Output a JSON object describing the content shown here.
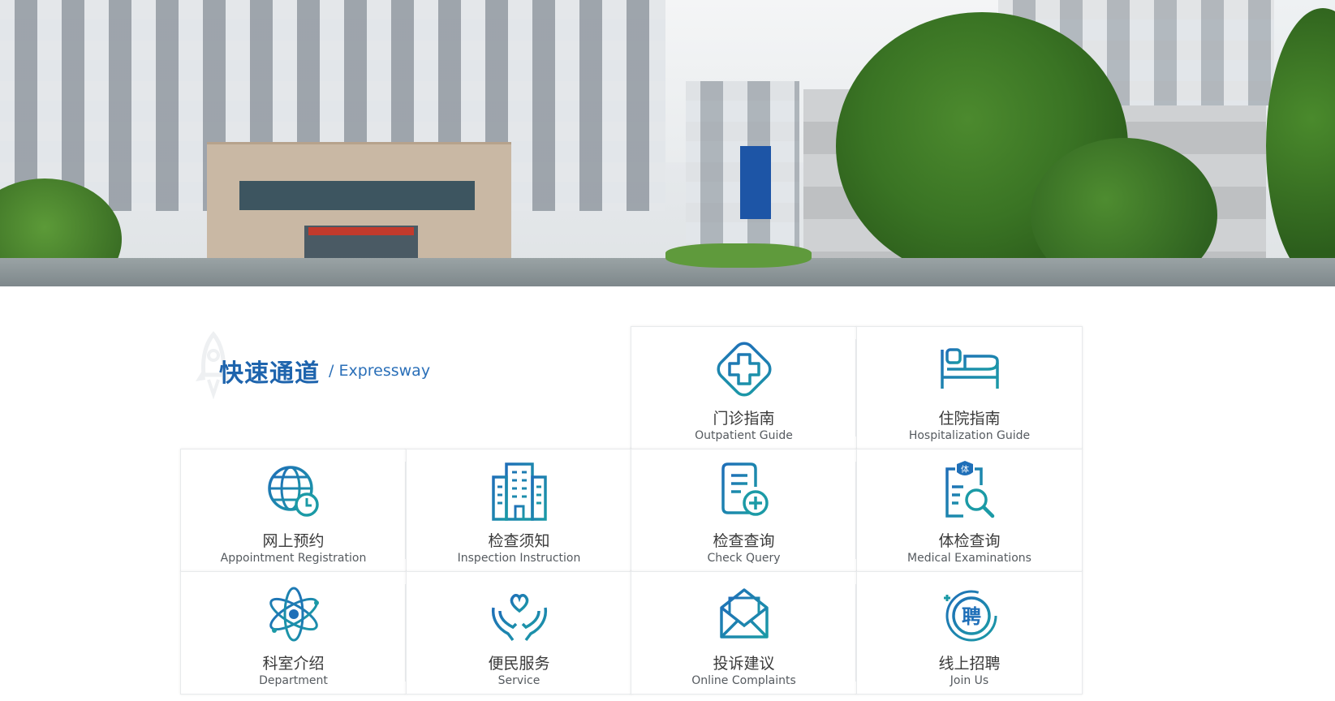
{
  "hero": {
    "image_desc": "hospital-buildings-photo"
  },
  "section": {
    "title_cn": "快速通道",
    "title_en": "/ Expressway"
  },
  "tiles": [
    {
      "cn": "门诊指南",
      "en": "Outpatient Guide",
      "icon": "medical-cross-icon"
    },
    {
      "cn": "住院指南",
      "en": "Hospitalization Guide",
      "icon": "hospital-bed-icon"
    },
    {
      "cn": "网上预约",
      "en": "Appointment Registration",
      "icon": "globe-clock-icon"
    },
    {
      "cn": "检查须知",
      "en": "Inspection Instruction",
      "icon": "building-icon"
    },
    {
      "cn": "检查查询",
      "en": "Check Query",
      "icon": "document-plus-icon"
    },
    {
      "cn": "体检查询",
      "en": "Medical Examinations",
      "icon": "clipboard-search-icon"
    },
    {
      "cn": "科室介绍",
      "en": "Department",
      "icon": "atom-icon"
    },
    {
      "cn": "便民服务",
      "en": "Service",
      "icon": "hands-heart-icon"
    },
    {
      "cn": "投诉建议",
      "en": "Online Complaints",
      "icon": "envelope-icon"
    },
    {
      "cn": "线上招聘",
      "en": "Join Us",
      "icon": "recruit-badge-icon"
    }
  ],
  "icon_badges": {
    "exam": "体",
    "recruit": "聘"
  },
  "colors": {
    "primary": "#1e64ad",
    "teal": "#1b9aa6",
    "icon_blue": "#1f6fb8"
  }
}
